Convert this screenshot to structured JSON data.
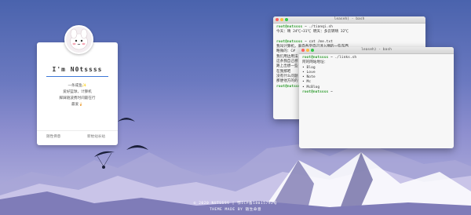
{
  "profile": {
    "name": "I'm N0tssss",
    "bio": [
      "一条咸鱼✨",
      "爱好篮球，计算机",
      "脚踩随波费时间最在行",
      "最爱🍦"
    ],
    "links": [
      {
        "label": "随性佛意"
      },
      {
        "label": "新枕站长站"
      }
    ]
  },
  "terminal_back": {
    "title": "leaseh) - bash",
    "lines": [
      {
        "prompt": "root@nutssss",
        "text": " ~ ./tianqi.sh"
      },
      {
        "prompt": "",
        "text": "今天：晴 24℃~31℃ 明天：多云转晴 32℃"
      },
      {
        "prompt": "",
        "text": ""
      },
      {
        "prompt": "root@nutssss",
        "text": " ~ cat /me.txt"
      },
      {
        "prompt": "",
        "text": "我叫计算机，来自各学自己涉入圈的一些东西"
      },
      {
        "prompt": "",
        "text": "略微的：C#"
      },
      {
        "prompt": "",
        "text": "我们用边用法"
      },
      {
        "prompt": "",
        "text": "这条我自己想"
      },
      {
        "prompt": "",
        "text": "路上出想一些"
      },
      {
        "prompt": "",
        "text": "在我那吧"
      },
      {
        "prompt": "",
        "text": "没有什么问题"
      },
      {
        "prompt": "",
        "text": "那便他方的的"
      },
      {
        "prompt": "root@nutssss",
        "text": " ~"
      }
    ]
  },
  "terminal_front": {
    "title": "leaseh) - bash",
    "lines": [
      {
        "prompt": "root@nutssss",
        "text": " ~ ./links.sh"
      },
      {
        "prompt": "",
        "text": "阿的网站地址："
      },
      {
        "prompt": "",
        "text": "• Blog"
      },
      {
        "prompt": "",
        "text": "• Love"
      },
      {
        "prompt": "",
        "text": "• Note"
      },
      {
        "prompt": "",
        "text": "• Mc"
      },
      {
        "prompt": "",
        "text": "• McBlog"
      },
      {
        "prompt": "root@nutssss",
        "text": " ~"
      }
    ]
  },
  "footer": {
    "line1": "© 2020 NUTSSSS | 鄂ICP备18015792号",
    "line2": "THEME MADE BY 随生命意"
  }
}
